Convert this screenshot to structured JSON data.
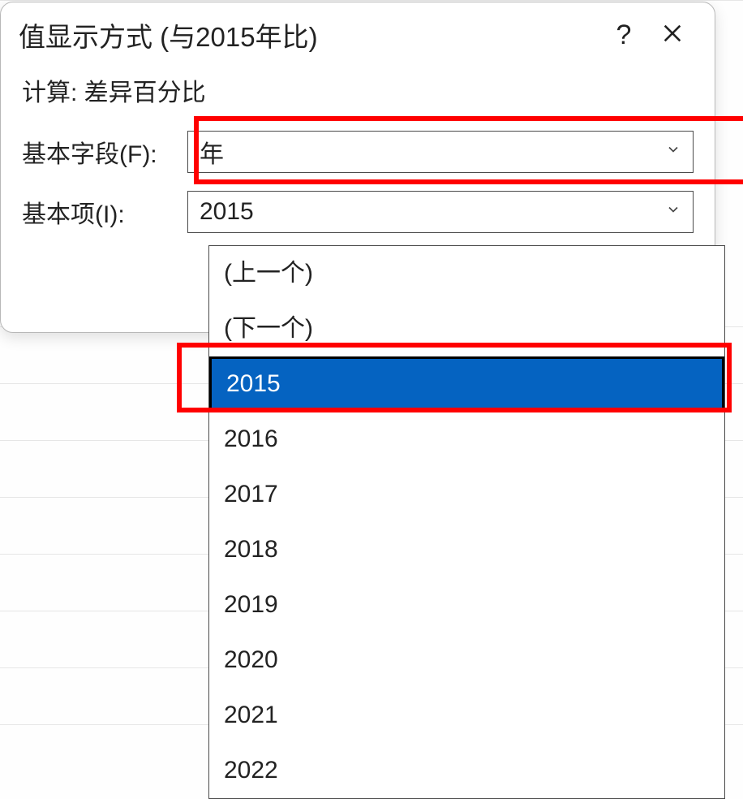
{
  "dialog": {
    "title": "值显示方式 (与2015年比)",
    "help_label": "?",
    "calc_label": "计算: 差异百分比",
    "base_field_label": "基本字段(F):",
    "base_field_value": "年",
    "base_item_label": "基本项(I):",
    "base_item_value": "2015"
  },
  "dropdown": {
    "items": [
      {
        "label": "(上一个)",
        "selected": false
      },
      {
        "label": "(下一个)",
        "selected": false
      },
      {
        "label": "2015",
        "selected": true
      },
      {
        "label": "2016",
        "selected": false
      },
      {
        "label": "2017",
        "selected": false
      },
      {
        "label": "2018",
        "selected": false
      },
      {
        "label": "2019",
        "selected": false
      },
      {
        "label": "2020",
        "selected": false
      },
      {
        "label": "2021",
        "selected": false
      },
      {
        "label": "2022",
        "selected": false
      }
    ]
  }
}
